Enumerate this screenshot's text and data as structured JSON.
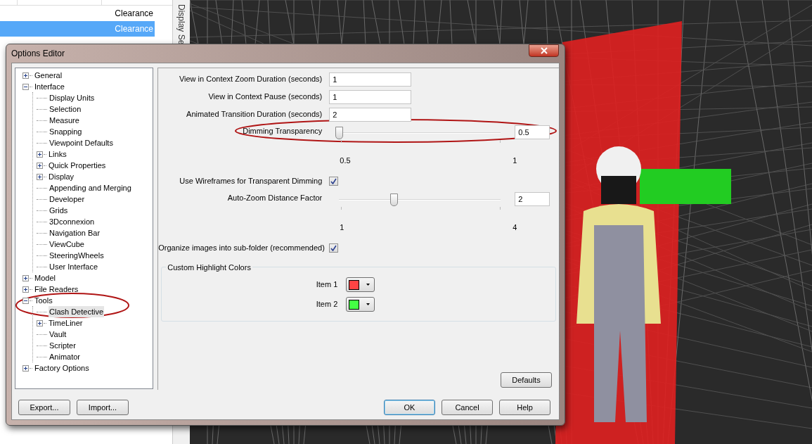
{
  "background_app": {
    "rows": [
      {
        "cell": "Clearance",
        "selected": false
      },
      {
        "cell": "Clearance",
        "selected": true
      }
    ],
    "side_tab": "Display Se"
  },
  "dialog": {
    "title": "Options Editor",
    "tree": [
      {
        "label": "General",
        "expanded": false,
        "selected": false
      },
      {
        "label": "Interface",
        "expanded": true,
        "selected": false,
        "children": [
          {
            "label": "Display Units",
            "selected": false
          },
          {
            "label": "Selection",
            "selected": false
          },
          {
            "label": "Measure",
            "selected": false
          },
          {
            "label": "Snapping",
            "selected": false
          },
          {
            "label": "Viewpoint Defaults",
            "selected": false
          },
          {
            "label": "Links",
            "expanded": false,
            "selected": false
          },
          {
            "label": "Quick Properties",
            "expanded": false,
            "selected": false
          },
          {
            "label": "Display",
            "expanded": false,
            "selected": false
          },
          {
            "label": "Appending and Merging",
            "selected": false
          },
          {
            "label": "Developer",
            "selected": false
          },
          {
            "label": "Grids",
            "selected": false
          },
          {
            "label": "3Dconnexion",
            "selected": false
          },
          {
            "label": "Navigation Bar",
            "selected": false
          },
          {
            "label": "ViewCube",
            "selected": false
          },
          {
            "label": "SteeringWheels",
            "selected": false
          },
          {
            "label": "User Interface",
            "selected": false
          }
        ]
      },
      {
        "label": "Model",
        "expanded": false,
        "selected": false
      },
      {
        "label": "File Readers",
        "expanded": false,
        "selected": false
      },
      {
        "label": "Tools",
        "expanded": true,
        "selected": false,
        "children": [
          {
            "label": "Clash Detective",
            "selected": true
          },
          {
            "label": "TimeLiner",
            "expanded": false,
            "selected": false
          },
          {
            "label": "Vault",
            "selected": false
          },
          {
            "label": "Scripter",
            "selected": false
          },
          {
            "label": "Animator",
            "selected": false
          }
        ]
      },
      {
        "label": "Factory Options",
        "expanded": false,
        "selected": false
      }
    ],
    "fields": [
      {
        "kind": "text",
        "label": "View in Context Zoom Duration (seconds)",
        "value": "1"
      },
      {
        "kind": "text",
        "label": "View in Context Pause (seconds)",
        "value": "1"
      },
      {
        "kind": "text",
        "label": "Animated Transition Duration (seconds)",
        "value": "2"
      },
      {
        "kind": "slider",
        "label": "Dimming Transparency",
        "level": 0,
        "value": "0.5",
        "min": "0.5",
        "max": "1"
      },
      {
        "kind": "checkbox",
        "label": "Use Wireframes for Transparent Dimming",
        "checked": true
      },
      {
        "kind": "slider",
        "label": "Auto-Zoom Distance Factor",
        "level": 0.34,
        "value": "2",
        "min": "1",
        "max": "4"
      },
      {
        "kind": "checkbox",
        "label": "Organize images into sub-folder (recommended)",
        "checked": true
      }
    ],
    "group": {
      "title": "Custom Highlight Colors",
      "items": [
        {
          "label": "Item 1",
          "color": "#ff4444"
        },
        {
          "label": "Item 2",
          "color": "#44ff44"
        }
      ]
    },
    "defaults_button": "Defaults",
    "left_buttons": [
      "Export...",
      "Import..."
    ],
    "right_buttons": [
      {
        "label": "OK",
        "default": true
      },
      {
        "label": "Cancel",
        "default": false
      },
      {
        "label": "Help",
        "default": false
      }
    ]
  }
}
